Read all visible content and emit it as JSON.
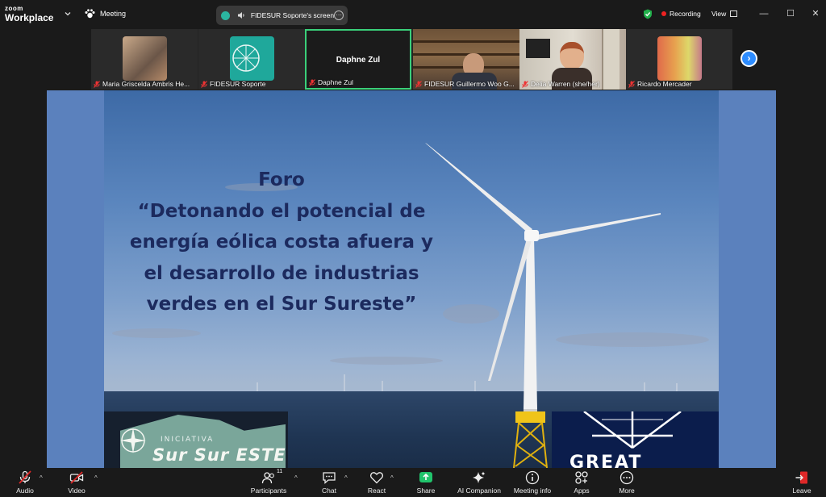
{
  "window": {
    "brand_top": "zoom",
    "brand_bottom": "Workplace",
    "meeting_label": "Meeting",
    "screen_label": "FIDESUR Soporte's screen",
    "recording_label": "Recording",
    "view_label": "View"
  },
  "participants": [
    {
      "name": "Maria Griscelda Ambris He..."
    },
    {
      "name": "FIDESUR Soporte"
    },
    {
      "name": "Daphne Zul",
      "display": "Daphne Zul"
    },
    {
      "name": "FIDESUR Guillermo Woo G..."
    },
    {
      "name": "Delia Warren (she/her)"
    },
    {
      "name": "Ricardo Mercader"
    }
  ],
  "slide": {
    "title_line1": "Foro",
    "title_line2": "“Detonando el potencial de",
    "title_line3": "energía eólica costa afuera y",
    "title_line4": "el desarrollo de industrias",
    "title_line5": "verdes en el Sur Sureste”",
    "logo_left_top": "INICIATIVA",
    "logo_left_main": "Sur Sur ESTE",
    "logo_right_text": "GREAT"
  },
  "toolbar": {
    "audio": "Audio",
    "video": "Video",
    "participants": "Participants",
    "participants_count": "11",
    "chat": "Chat",
    "react": "React",
    "share": "Share",
    "ai_companion": "AI Companion",
    "meeting_info": "Meeting info",
    "apps": "Apps",
    "more": "More",
    "leave": "Leave"
  },
  "colors": {
    "accent_green": "#3ad07a",
    "share_green": "#21c46c",
    "leave_red": "#e02828",
    "nav_blue": "#2d8cff",
    "slide_title": "#1c2a5e"
  }
}
